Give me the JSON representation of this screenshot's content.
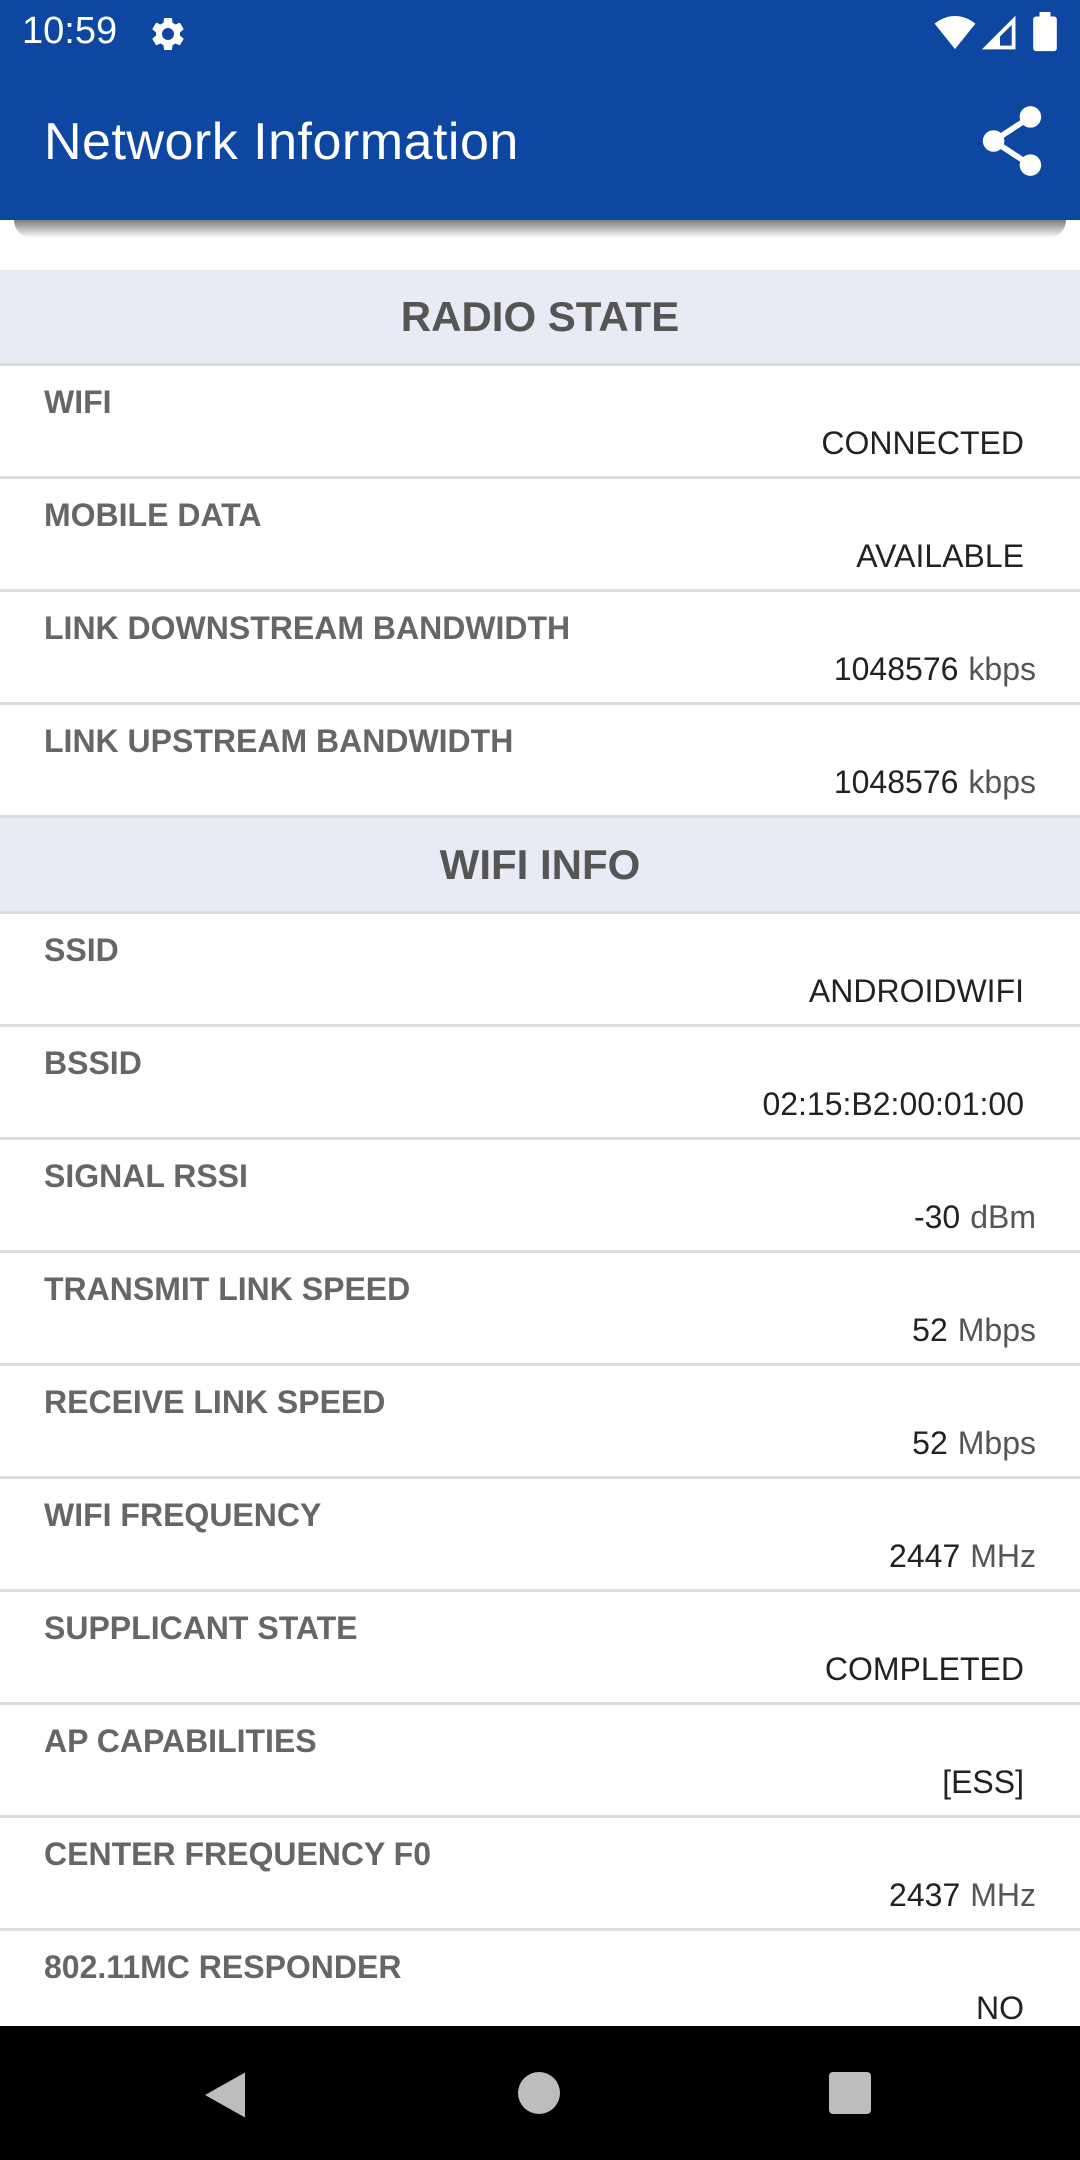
{
  "status_bar": {
    "time": "10:59"
  },
  "app_bar": {
    "title": "Network Information"
  },
  "sections": [
    {
      "header": "RADIO STATE",
      "rows": [
        {
          "label": "WIFI",
          "value": "CONNECTED"
        },
        {
          "label": "MOBILE DATA",
          "value": "AVAILABLE"
        },
        {
          "label": "LINK DOWNSTREAM BANDWIDTH",
          "value": "1048576",
          "unit": "kbps"
        },
        {
          "label": "LINK UPSTREAM BANDWIDTH",
          "value": "1048576",
          "unit": "kbps"
        }
      ]
    },
    {
      "header": "WIFI INFO",
      "rows": [
        {
          "label": "SSID",
          "value": "ANDROIDWIFI"
        },
        {
          "label": "BSSID",
          "value": "02:15:B2:00:01:00"
        },
        {
          "label": "SIGNAL RSSI",
          "value": "-30",
          "unit": "dBm"
        },
        {
          "label": "TRANSMIT LINK SPEED",
          "value": "52",
          "unit": "Mbps"
        },
        {
          "label": "RECEIVE LINK SPEED",
          "value": "52",
          "unit": "Mbps"
        },
        {
          "label": "WIFI FREQUENCY",
          "value": "2447",
          "unit": "MHz"
        },
        {
          "label": "SUPPLICANT STATE",
          "value": "COMPLETED"
        },
        {
          "label": "AP CAPABILITIES",
          "value": "[ESS]"
        },
        {
          "label": "CENTER FREQUENCY F0",
          "value": "2437",
          "unit": "MHz"
        },
        {
          "label": "802.11MC RESPONDER",
          "value": "NO"
        }
      ]
    }
  ],
  "icons": {
    "status": [
      "gear-icon",
      "wifi-icon",
      "cell-signal-icon",
      "battery-icon"
    ],
    "app_bar": [
      "share-icon"
    ],
    "nav": [
      "back-icon",
      "home-icon",
      "recents-icon"
    ]
  },
  "colors": {
    "primary": "#0d47a1",
    "section_header_bg": "#e8eaf6",
    "divider": "#dcdcdc"
  }
}
